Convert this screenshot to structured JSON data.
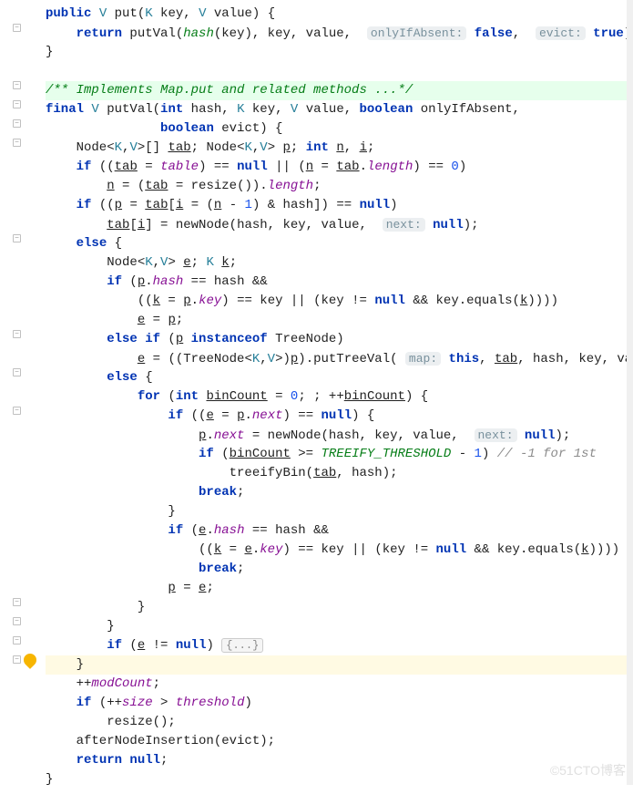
{
  "folds": [
    0,
    1,
    2,
    0,
    1,
    1,
    1,
    1,
    0,
    0,
    0,
    0,
    1,
    0,
    0,
    0,
    0,
    1,
    0,
    1,
    0,
    1,
    0,
    0,
    0,
    0,
    0,
    0,
    0,
    0,
    0,
    1,
    1,
    1,
    1,
    0,
    0,
    0,
    0,
    0,
    0
  ],
  "bulbRow": 34,
  "highlightRow": 34,
  "docRows": [
    4
  ],
  "watermark": "©51CTO博客",
  "lines": {
    "l0": {
      "a": "public",
      "b": "V",
      "c": "put(",
      "d": "K",
      "e": "key, ",
      "f": "V",
      "g": "value) {"
    },
    "l1": {
      "a": "return",
      "b": "putVal(",
      "c": "hash",
      "d": "(key), key, value, ",
      "h1": "onlyIfAbsent:",
      "v1": "false",
      "e": ", ",
      "h2": "evict:",
      "v2": "true",
      "f": ");"
    },
    "l2": "}",
    "l4": "/** Implements Map.put and related methods ...*/",
    "l5": {
      "a": "final",
      "b": "V",
      "c": "putVal(",
      "d": "int",
      "e": "hash, ",
      "f": "K",
      "g": "key, ",
      "h": "V",
      "i": "value, ",
      "j": "boolean",
      "k": "onlyIfAbsent,"
    },
    "l6": {
      "a": "boolean",
      "b": "evict) {"
    },
    "l7": {
      "a": "Node<",
      "b": "K",
      "c": ",",
      "d": "V",
      "e": ">[] ",
      "f": "tab",
      "g": "; Node<",
      "h": "K",
      "i": ",",
      "j": "V",
      "k": "> ",
      "l": "p",
      "m": "; ",
      "n": "int",
      "o": "n",
      "p": ", ",
      "q": "i",
      "r": ";"
    },
    "l8": {
      "a": "if",
      "b": "((",
      "c": "tab",
      "d": " = ",
      "e": "table",
      "f": ") == ",
      "g": "null",
      "h": " || (",
      "i": "n",
      "j": " = ",
      "k": "tab",
      "l": ".",
      "m": "length",
      "n": ") == ",
      "o": "0",
      "p": ")"
    },
    "l9": {
      "a": "n",
      "b": " = (",
      "c": "tab",
      "d": " = resize()).",
      "e": "length",
      "f": ";"
    },
    "l10": {
      "a": "if",
      "b": "((",
      "c": "p",
      "d": " = ",
      "e": "tab",
      "f": "[",
      "g": "i",
      "h": " = (",
      "i": "n",
      "j": " - ",
      "k": "1",
      "l": ") & hash]) == ",
      "m": "null",
      "n": ")"
    },
    "l11": {
      "a": "tab",
      "b": "[",
      "c": "i",
      "d": "] = newNode(hash, key, value, ",
      "h1": "next:",
      "v1": "null",
      "e": ");"
    },
    "l12": {
      "a": "else",
      "b": "{"
    },
    "l13": {
      "a": "Node<",
      "b": "K",
      "c": ",",
      "d": "V",
      "e": "> ",
      "f": "e",
      "g": "; ",
      "h": "K",
      "i": "k",
      "j": ";"
    },
    "l14": {
      "a": "if",
      "b": "(",
      "c": "p",
      "d": ".",
      "e": "hash",
      "f": " == hash &&"
    },
    "l15": {
      "a": "((",
      "b": "k",
      "c": " = ",
      "d": "p",
      "e": ".",
      "f": "key",
      "g": ") == key || (key != ",
      "h": "null",
      "i": " && key.equals(",
      "j": "k",
      "k": "))))"
    },
    "l16": {
      "a": "e",
      "b": " = ",
      "c": "p",
      "d": ";"
    },
    "l17": {
      "a": "else if",
      "b": "(",
      "c": "p",
      "d": "instanceof",
      "e": "TreeNode)"
    },
    "l18": {
      "a": "e",
      "b": " = ((TreeNode<",
      "c": "K",
      "d": ",",
      "e": "V",
      "f": ">)",
      "g": "p",
      "h": ").putTreeVal(",
      "h1": "map:",
      "v1": "this",
      "i": ", ",
      "j": "tab",
      "k": ", hash, key, value);"
    },
    "l19": {
      "a": "else",
      "b": "{"
    },
    "l20": {
      "a": "for",
      "b": "(",
      "c": "int",
      "d": "binCount",
      "e": " = ",
      "f": "0",
      "g": "; ; ++",
      "h": "binCount",
      "i": ") {"
    },
    "l21": {
      "a": "if",
      "b": "((",
      "c": "e",
      "d": " = ",
      "e": "p",
      "f": ".",
      "g": "next",
      "h": ") == ",
      "i": "null",
      "j": ") {"
    },
    "l22": {
      "a": "p",
      "b": ".",
      "c": "next",
      "d": " = newNode(hash, key, value, ",
      "h1": "next:",
      "v1": "null",
      "e": ");"
    },
    "l23": {
      "a": "if",
      "b": "(",
      "c": "binCount",
      "d": " >= ",
      "e": "TREEIFY_THRESHOLD",
      "f": " - ",
      "g": "1",
      "h": ") ",
      "i": "// -1 for 1st"
    },
    "l24": {
      "a": "treeifyBin(",
      "b": "tab",
      "c": ", hash);"
    },
    "l25": {
      "a": "break",
      "b": ";"
    },
    "l26": "}",
    "l27": {
      "a": "if",
      "b": "(",
      "c": "e",
      "d": ".",
      "e": "hash",
      "f": " == hash &&"
    },
    "l28": {
      "a": "((",
      "b": "k",
      "c": " = ",
      "d": "e",
      "e": ".",
      "f": "key",
      "g": ") == key || (key != ",
      "h": "null",
      "i": " && key.equals(",
      "j": "k",
      "k": "))))"
    },
    "l29": {
      "a": "break",
      "b": ";"
    },
    "l30": {
      "a": "p",
      "b": " = ",
      "c": "e",
      "d": ";"
    },
    "l31": "}",
    "l32": "}",
    "l33": {
      "a": "if",
      "b": "(",
      "c": "e",
      "d": " != ",
      "e": "null",
      "f": ") ",
      "g": "{...}"
    },
    "l34": "}",
    "l35": {
      "a": "++",
      "b": "modCount",
      "c": ";"
    },
    "l36": {
      "a": "if",
      "b": "(++",
      "c": "size",
      "d": " > ",
      "e": "threshold",
      "f": ")"
    },
    "l37": "resize();",
    "l38": "afterNodeInsertion(evict);",
    "l39": {
      "a": "return null",
      "b": ";"
    },
    "l40": "}"
  }
}
